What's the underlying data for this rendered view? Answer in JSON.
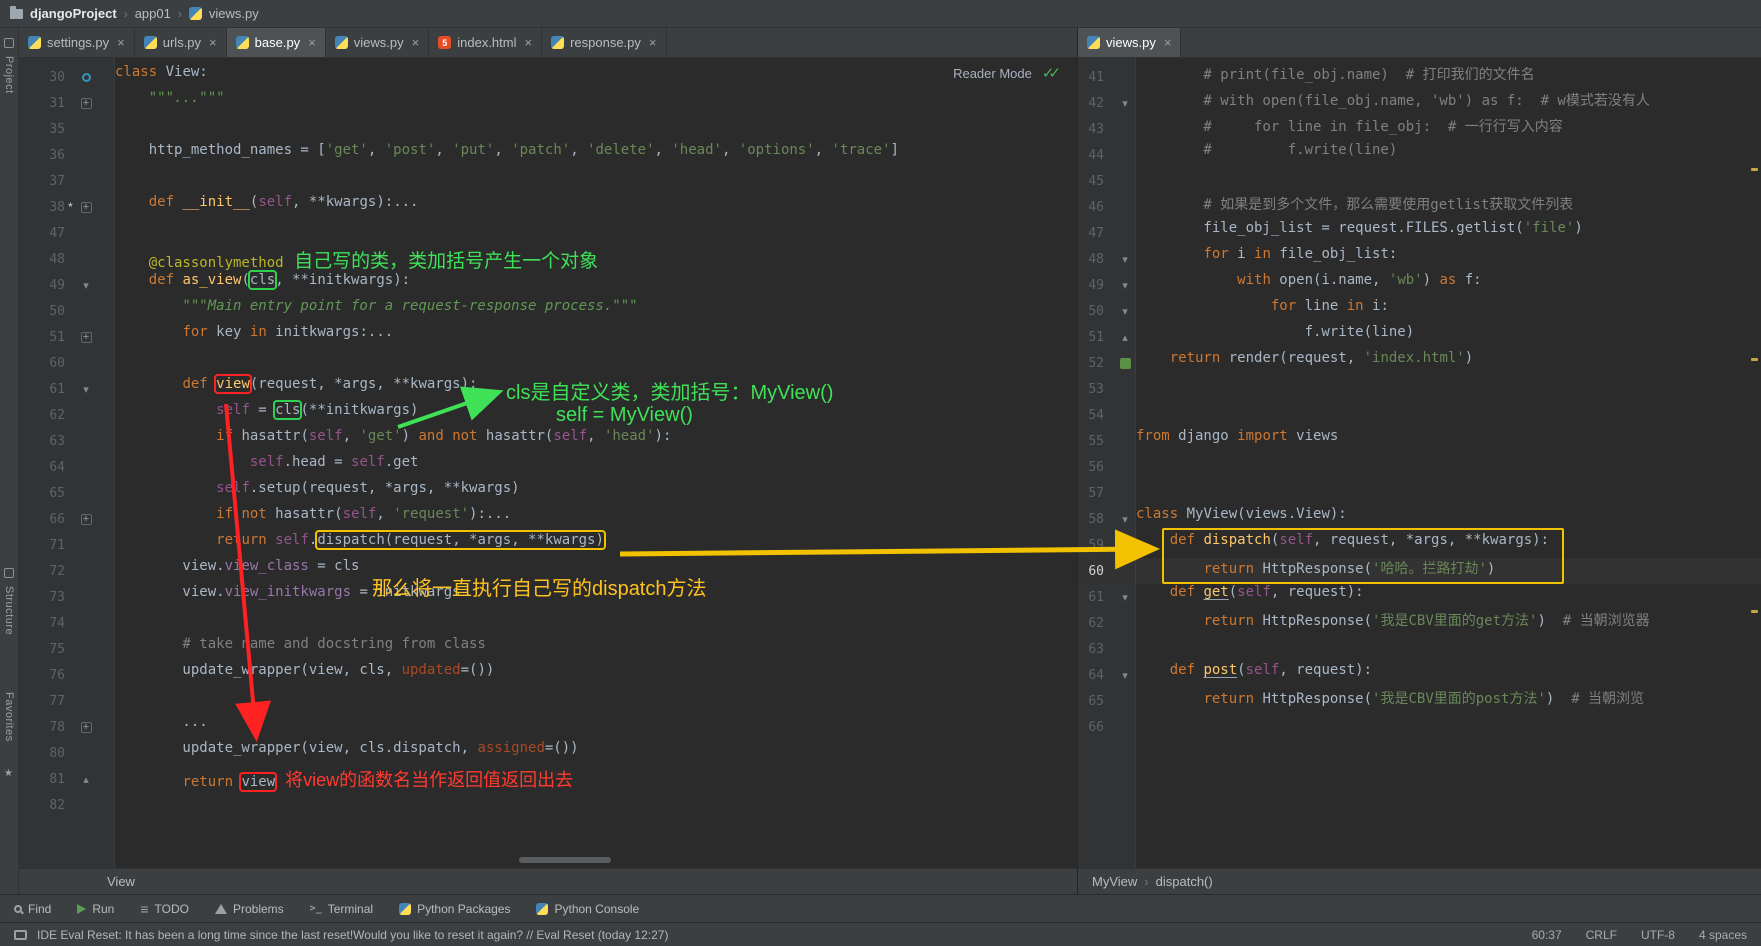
{
  "window": {
    "breadcrumbs": [
      "djangoProject",
      "app01",
      "views.py"
    ],
    "reader_mode": "Reader Mode"
  },
  "stripe": {
    "project": "Project",
    "structure": "Structure",
    "favorites": "Favorites"
  },
  "left_pane": {
    "tabs": [
      {
        "label": "settings.py",
        "active": false
      },
      {
        "label": "urls.py",
        "active": false
      },
      {
        "label": "base.py",
        "active": true
      },
      {
        "label": "views.py",
        "active": false
      },
      {
        "label": "index.html",
        "active": false,
        "icon": "html"
      },
      {
        "label": "response.py",
        "active": false
      }
    ],
    "breadcrumb": "View",
    "lines": [
      {
        "n": "30",
        "ic": "target",
        "tok": [
          [
            "kw",
            "class"
          ],
          [
            "pl",
            " View:"
          ]
        ]
      },
      {
        "n": "31",
        "ic": "fold+",
        "tok": [
          [
            "ds",
            "    \"\"\"...\"\"\""
          ]
        ]
      },
      {
        "n": "35",
        "tok": []
      },
      {
        "n": "36",
        "tok": [
          [
            "pl",
            "    http_method_names = ["
          ],
          [
            "st",
            "'get'"
          ],
          [
            "pl",
            ", "
          ],
          [
            "st",
            "'post'"
          ],
          [
            "pl",
            ", "
          ],
          [
            "st",
            "'put'"
          ],
          [
            "pl",
            ", "
          ],
          [
            "st",
            "'patch'"
          ],
          [
            "pl",
            ", "
          ],
          [
            "st",
            "'delete'"
          ],
          [
            "pl",
            ", "
          ],
          [
            "st",
            "'head'"
          ],
          [
            "pl",
            ", "
          ],
          [
            "st",
            "'options'"
          ],
          [
            "pl",
            ", "
          ],
          [
            "st",
            "'trace'"
          ],
          [
            "pl",
            "]"
          ]
        ]
      },
      {
        "n": "37",
        "tok": []
      },
      {
        "n": "38",
        "star": true,
        "ic": "fold+",
        "tok": [
          [
            "pl",
            "    "
          ],
          [
            "kw",
            "def "
          ],
          [
            "fn",
            "__init__"
          ],
          [
            "pl",
            "("
          ],
          [
            "sf",
            "self"
          ],
          [
            "pl",
            ", **kwargs):"
          ],
          [
            "pl",
            "..."
          ]
        ]
      },
      {
        "n": "47",
        "tok": []
      },
      {
        "n": "48",
        "tok": [
          [
            "pl",
            "    "
          ],
          [
            "dc",
            "@classonlymethod"
          ],
          [
            "ag",
            "  自己写的类，类加括号产生一个对象"
          ]
        ]
      },
      {
        "n": "49",
        "ic": "foldv",
        "tok": [
          [
            "pl",
            "    "
          ],
          [
            "kw",
            "def "
          ],
          [
            "fn",
            "as_view"
          ],
          [
            "pl",
            "("
          ],
          [
            "pl",
            "cls",
            "g"
          ],
          [
            "pl",
            ", **initkwargs):"
          ]
        ]
      },
      {
        "n": "50",
        "tok": [
          [
            "ds",
            "        \"\"\"Main entry point for a request-response process.\"\"\""
          ]
        ]
      },
      {
        "n": "51",
        "ic": "fold+",
        "tok": [
          [
            "pl",
            "        "
          ],
          [
            "kw",
            "for"
          ],
          [
            "pl",
            " key "
          ],
          [
            "kw",
            "in"
          ],
          [
            "pl",
            " initkwargs:"
          ],
          [
            "pl",
            "..."
          ]
        ]
      },
      {
        "n": "60",
        "tok": []
      },
      {
        "n": "61",
        "ic": "foldv",
        "tok": [
          [
            "pl",
            "        "
          ],
          [
            "kw",
            "def "
          ],
          [
            "fn",
            "view",
            "r"
          ],
          [
            "pl",
            "(request, *args, **kwargs):"
          ]
        ]
      },
      {
        "n": "62",
        "tok": [
          [
            "pl",
            "            "
          ],
          [
            "sf",
            "self"
          ],
          [
            "pl",
            " = "
          ],
          [
            "pl",
            "cls",
            "g"
          ],
          [
            "pl",
            "(**initkwargs)"
          ]
        ]
      },
      {
        "n": "63",
        "tok": [
          [
            "pl",
            "            "
          ],
          [
            "kw",
            "if"
          ],
          [
            "pl",
            " hasattr("
          ],
          [
            "sf",
            "self"
          ],
          [
            "pl",
            ", "
          ],
          [
            "st",
            "'get'"
          ],
          [
            "pl",
            ") "
          ],
          [
            "kw",
            "and"
          ],
          [
            "pl",
            " "
          ],
          [
            "kw",
            "not"
          ],
          [
            "pl",
            " hasattr("
          ],
          [
            "sf",
            "self"
          ],
          [
            "pl",
            ", "
          ],
          [
            "st",
            "'head'"
          ],
          [
            "pl",
            "):"
          ]
        ]
      },
      {
        "n": "64",
        "tok": [
          [
            "pl",
            "                "
          ],
          [
            "sf",
            "self"
          ],
          [
            "pl",
            ".head = "
          ],
          [
            "sf",
            "self"
          ],
          [
            "pl",
            ".get"
          ]
        ]
      },
      {
        "n": "65",
        "tok": [
          [
            "pl",
            "            "
          ],
          [
            "sf",
            "self"
          ],
          [
            "pl",
            ".setup(request, *args, **kwargs)"
          ]
        ]
      },
      {
        "n": "66",
        "ic": "fold+",
        "tok": [
          [
            "pl",
            "            "
          ],
          [
            "kw",
            "if"
          ],
          [
            "pl",
            " "
          ],
          [
            "kw",
            "not"
          ],
          [
            "pl",
            " hasattr("
          ],
          [
            "sf",
            "self"
          ],
          [
            "pl",
            ", "
          ],
          [
            "st",
            "'request'"
          ],
          [
            "pl",
            "):"
          ],
          [
            "pl",
            "..."
          ]
        ]
      },
      {
        "n": "71",
        "tok": [
          [
            "pl",
            "            "
          ],
          [
            "kw",
            "return"
          ],
          [
            "pl",
            " "
          ],
          [
            "sf",
            "self"
          ],
          [
            "pl",
            "."
          ],
          [
            "pl",
            "dispatch(request, *args, **kwargs)",
            "y"
          ]
        ]
      },
      {
        "n": "72",
        "tok": [
          [
            "pl",
            "        view."
          ],
          [
            "fd",
            "view_class"
          ],
          [
            "pl",
            " = cls"
          ]
        ]
      },
      {
        "n": "73",
        "tok": [
          [
            "pl",
            "        view."
          ],
          [
            "fd",
            "view_initkwargs"
          ],
          [
            "pl",
            " = initkwargs"
          ]
        ]
      },
      {
        "n": "74",
        "tok": []
      },
      {
        "n": "75",
        "tok": [
          [
            "cm",
            "        # take name and docstring from class"
          ]
        ]
      },
      {
        "n": "76",
        "tok": [
          [
            "pl",
            "        update_wrapper(view, cls, "
          ],
          [
            "pm",
            "updated"
          ],
          [
            "pl",
            "=())"
          ]
        ]
      },
      {
        "n": "77",
        "tok": []
      },
      {
        "n": "78",
        "ic": "fold+",
        "tok": [
          [
            "pl",
            "        ..."
          ]
        ]
      },
      {
        "n": "80",
        "tok": [
          [
            "pl",
            "        update_wrapper(view, cls.dispatch, "
          ],
          [
            "pm",
            "assigned"
          ],
          [
            "pl",
            "=())"
          ]
        ]
      },
      {
        "n": "81",
        "ic": "folda",
        "tok": [
          [
            "pl",
            "        "
          ],
          [
            "kw",
            "return"
          ],
          [
            "pl",
            " "
          ],
          [
            "pl",
            "view",
            "r"
          ],
          [
            "ar",
            "  将view的函数名当作返回值返回出去"
          ]
        ]
      },
      {
        "n": "82",
        "tok": []
      }
    ]
  },
  "right_pane": {
    "tabs": [
      {
        "label": "views.py",
        "active": true
      }
    ],
    "breadcrumb": [
      "MyView",
      "dispatch()"
    ],
    "lines": [
      {
        "n": "41",
        "tok": [
          [
            "cm",
            "        # print(file_obj.name)  # 打印我们的文件名"
          ]
        ]
      },
      {
        "n": "42",
        "ic": "foldv",
        "tok": [
          [
            "cm",
            "        # with open(file_obj.name, 'wb') as f:  # w模式若没有人"
          ]
        ]
      },
      {
        "n": "43",
        "tok": [
          [
            "cm",
            "        #     for line in file_obj:  # 一行行写入内容"
          ]
        ]
      },
      {
        "n": "44",
        "tok": [
          [
            "cm",
            "        #         f.write(line)"
          ]
        ]
      },
      {
        "n": "45",
        "tok": []
      },
      {
        "n": "46",
        "tok": [
          [
            "cm",
            "        # 如果是到多个文件，那么需要使用getlist获取文件列表"
          ]
        ]
      },
      {
        "n": "47",
        "tok": [
          [
            "pl",
            "        file_obj_list = request.FILES.getlist("
          ],
          [
            "st",
            "'file'"
          ],
          [
            "pl",
            ")"
          ]
        ]
      },
      {
        "n": "48",
        "ic": "foldv",
        "tok": [
          [
            "pl",
            "        "
          ],
          [
            "kw",
            "for"
          ],
          [
            "pl",
            " i "
          ],
          [
            "kw",
            "in"
          ],
          [
            "pl",
            " file_obj_list:"
          ]
        ]
      },
      {
        "n": "49",
        "ic": "foldv",
        "tok": [
          [
            "pl",
            "            "
          ],
          [
            "kw",
            "with"
          ],
          [
            "pl",
            " open(i.name, "
          ],
          [
            "st",
            "'wb'"
          ],
          [
            "pl",
            ") "
          ],
          [
            "kw",
            "as"
          ],
          [
            "pl",
            " f:"
          ]
        ]
      },
      {
        "n": "50",
        "ic": "foldv",
        "tok": [
          [
            "pl",
            "                "
          ],
          [
            "kw",
            "for"
          ],
          [
            "pl",
            " line "
          ],
          [
            "kw",
            "in"
          ],
          [
            "pl",
            " i:"
          ]
        ]
      },
      {
        "n": "51",
        "ic": "folda",
        "tok": [
          [
            "pl",
            "                    f.write(line)"
          ]
        ]
      },
      {
        "n": "52",
        "ic": "tpl",
        "tok": [
          [
            "pl",
            "    "
          ],
          [
            "kw",
            "return"
          ],
          [
            "pl",
            " render(request, "
          ],
          [
            "st",
            "'index.html'"
          ],
          [
            "pl",
            ")"
          ]
        ]
      },
      {
        "n": "53",
        "tok": []
      },
      {
        "n": "54",
        "tok": []
      },
      {
        "n": "55",
        "tok": [
          [
            "kw",
            "from"
          ],
          [
            "pl",
            " django "
          ],
          [
            "kw",
            "import"
          ],
          [
            "pl",
            " views"
          ]
        ]
      },
      {
        "n": "56",
        "tok": []
      },
      {
        "n": "57",
        "tok": []
      },
      {
        "n": "58",
        "ic": "foldv",
        "tok": [
          [
            "kw",
            "class"
          ],
          [
            "pl",
            " MyView(views.View):"
          ]
        ]
      },
      {
        "n": "59",
        "ic": "target",
        "tok": [
          [
            "pl",
            "    "
          ],
          [
            "kw",
            "def "
          ],
          [
            "fn",
            "dispatch"
          ],
          [
            "pl",
            "("
          ],
          [
            "sf",
            "self"
          ],
          [
            "pl",
            ", request, *args, **kwargs):"
          ]
        ]
      },
      {
        "n": "60",
        "hl": true,
        "tok": [
          [
            "pl",
            "        "
          ],
          [
            "kw",
            "return"
          ],
          [
            "pl",
            " HttpResponse("
          ],
          [
            "st",
            "'哈哈。拦路打劫'"
          ],
          [
            "pl",
            ")"
          ]
        ]
      },
      {
        "n": "61",
        "ic": "foldv",
        "tok": [
          [
            "pl",
            "    "
          ],
          [
            "kw",
            "def "
          ],
          [
            "fn",
            "get",
            "u"
          ],
          [
            "pl",
            "("
          ],
          [
            "sf",
            "self"
          ],
          [
            "pl",
            ", request):"
          ]
        ]
      },
      {
        "n": "62",
        "tok": [
          [
            "pl",
            "        "
          ],
          [
            "kw",
            "return"
          ],
          [
            "pl",
            " HttpResponse("
          ],
          [
            "st",
            "'我是CBV里面的get方法'"
          ],
          [
            "pl",
            ")  "
          ],
          [
            "cm",
            "# 当朝浏览器"
          ]
        ]
      },
      {
        "n": "63",
        "tok": []
      },
      {
        "n": "64",
        "ic": "foldv",
        "tok": [
          [
            "pl",
            "    "
          ],
          [
            "kw",
            "def "
          ],
          [
            "fn",
            "post",
            "u"
          ],
          [
            "pl",
            "("
          ],
          [
            "sf",
            "self"
          ],
          [
            "pl",
            ", request):"
          ]
        ]
      },
      {
        "n": "65",
        "tok": [
          [
            "pl",
            "        "
          ],
          [
            "kw",
            "return"
          ],
          [
            "pl",
            " HttpResponse("
          ],
          [
            "st",
            "'我是CBV里面的post方法'"
          ],
          [
            "pl",
            ")  "
          ],
          [
            "cm",
            "# 当朝浏览"
          ]
        ]
      },
      {
        "n": "66",
        "tok": []
      }
    ]
  },
  "annotations": {
    "note_cls_custom": "cls是自定义类，类加括号：MyView()",
    "note_self_myview": "self = MyView()",
    "note_dispatch": "那么将一直执行自己写的dispatch方法"
  },
  "toolbar": {
    "items": [
      "Find",
      "Run",
      "TODO",
      "Problems",
      "Terminal",
      "Python Packages",
      "Python Console"
    ]
  },
  "status": {
    "message": "IDE Eval Reset: It has been a long time since the last reset!Would you like to reset it again? // Eval Reset (today 12:27)",
    "position": "60:37",
    "line_ending": "CRLF",
    "encoding": "UTF-8",
    "indent": "4 spaces"
  }
}
